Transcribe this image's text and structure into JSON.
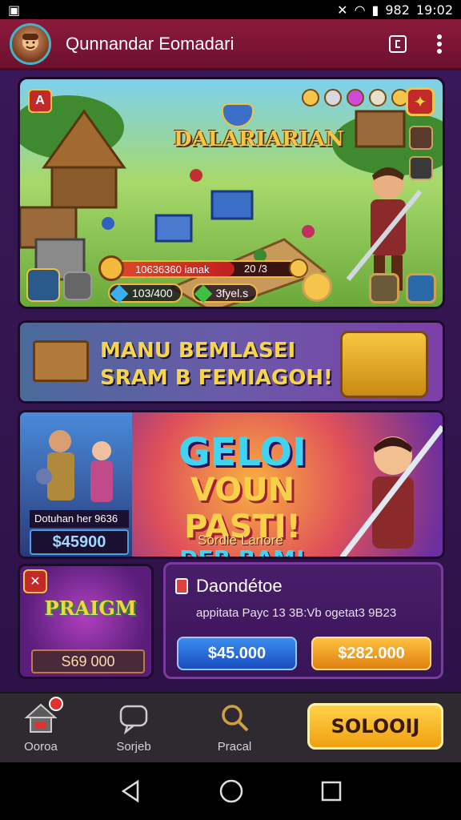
{
  "status_bar": {
    "time": "19:02",
    "battery_text": "982"
  },
  "app_bar": {
    "title": "Qunnandar Eomadari"
  },
  "hero": {
    "game_logo": "DALARIARIAN",
    "level_badge": "A",
    "xp_text": "10636360 ianak",
    "xp_end": "20 /3",
    "xp_progress": 0.65,
    "resource_1": "103/400",
    "resource_2": "3fyel.s"
  },
  "banner1": {
    "line1": "MANU BEMLASEI",
    "line2": "SRAM B FEMIAGOH!"
  },
  "banner2": {
    "card_label": "Dotuhan her 9636",
    "card_price": "$45900",
    "headline_1": "GELOI",
    "headline_2": "VOUN PASTI!",
    "headline_3": "DER RAM!",
    "subtext": "Sordie Lanore"
  },
  "card_left": {
    "logo_text": "PRAIGM",
    "price": "S69 000"
  },
  "card_right": {
    "title": "Daondétoe",
    "description": "appitata Payc 13 3B:Vb ogetat3 9B23",
    "button_blue": "$45.000",
    "button_orange": "$282.000"
  },
  "bottom_nav": {
    "home_label": "Ooroa",
    "item2_label": "Sorjeb",
    "item3_label": "Pracal",
    "cta_label": "SOLOOIJ"
  },
  "colors": {
    "app_bar": "#8b1a3c",
    "background": "#2a1240",
    "blue_button": "#3a8cf0",
    "orange_button": "#f0a010",
    "cta": "#ffd24a"
  }
}
